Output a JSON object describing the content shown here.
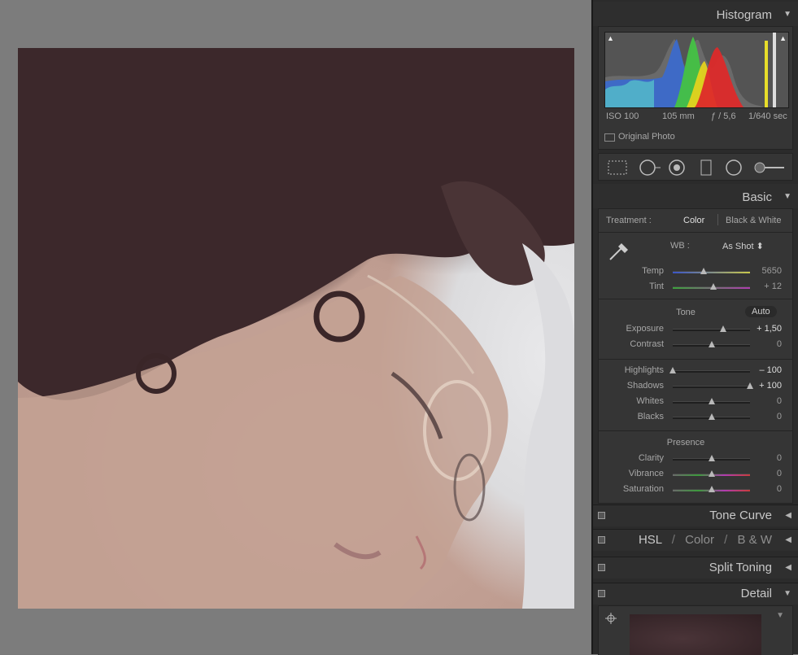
{
  "histogram": {
    "title": "Histogram",
    "iso": "ISO 100",
    "focal": "105 mm",
    "aperture": "ƒ / 5,6",
    "shutter": "1/640 sec",
    "original_label": "Original Photo"
  },
  "basic": {
    "title": "Basic",
    "treatment_label": "Treatment :",
    "treatment_color": "Color",
    "treatment_bw": "Black & White",
    "wb_label": "WB :",
    "wb_value": "As Shot ⬍",
    "temp": {
      "label": "Temp",
      "value": "5650",
      "level": 0.4
    },
    "tint": {
      "label": "Tint",
      "value": "+ 12",
      "level": 0.53
    },
    "tone_title": "Tone",
    "auto_label": "Auto",
    "exposure": {
      "label": "Exposure",
      "value": "+ 1,50",
      "level": 0.65
    },
    "contrast": {
      "label": "Contrast",
      "value": "0",
      "level": 0.5
    },
    "highlights": {
      "label": "Highlights",
      "value": "– 100",
      "level": 0.0
    },
    "shadows": {
      "label": "Shadows",
      "value": "+ 100",
      "level": 1.0
    },
    "whites": {
      "label": "Whites",
      "value": "0",
      "level": 0.5
    },
    "blacks": {
      "label": "Blacks",
      "value": "0",
      "level": 0.5
    },
    "presence_title": "Presence",
    "clarity": {
      "label": "Clarity",
      "value": "0",
      "level": 0.5
    },
    "vibrance": {
      "label": "Vibrance",
      "value": "0",
      "level": 0.5
    },
    "saturation": {
      "label": "Saturation",
      "value": "0",
      "level": 0.5
    }
  },
  "panels": {
    "tone_curve": "Tone Curve",
    "hsl": "HSL",
    "hsl_sep": "/",
    "color": "Color",
    "bw": "B & W",
    "split_toning": "Split Toning",
    "detail": "Detail"
  },
  "colors": {
    "panel_bg": "#2b2b2b",
    "text": "#bdbdbd",
    "canvas": "#7c7c7c"
  }
}
